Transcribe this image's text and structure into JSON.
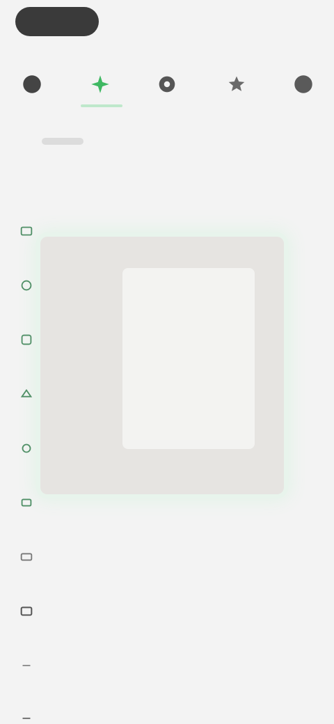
{
  "top_bar": {
    "pill_label": ""
  },
  "icon_strip": {
    "items": [
      {
        "name": "home",
        "label": ""
      },
      {
        "name": "ai",
        "label": ""
      },
      {
        "name": "settings",
        "label": ""
      },
      {
        "name": "star",
        "label": ""
      },
      {
        "name": "more",
        "label": ""
      }
    ],
    "active_index": 1
  },
  "section": {
    "title": ""
  },
  "list": {
    "items": [
      {
        "label": ""
      },
      {
        "label": ""
      },
      {
        "label": ""
      },
      {
        "label": ""
      },
      {
        "label": ""
      },
      {
        "label": ""
      },
      {
        "label": ""
      },
      {
        "label": ""
      },
      {
        "label": ""
      },
      {
        "label": ""
      }
    ]
  },
  "colors": {
    "accent": "#36b35a",
    "background": "#f3f3f3",
    "text": "#2a2a2a",
    "icon": "#4a4a4a"
  }
}
